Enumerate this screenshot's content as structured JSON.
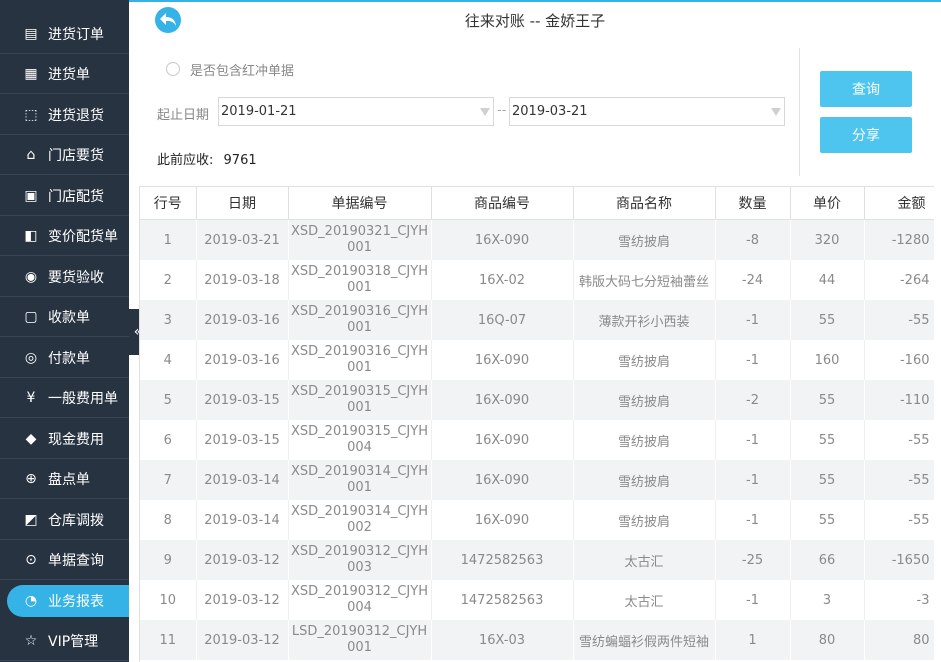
{
  "sidebar": {
    "items": [
      {
        "label": "进货订单",
        "icon": "purchase-order-icon"
      },
      {
        "label": "进货单",
        "icon": "purchase-receipt-icon"
      },
      {
        "label": "进货退货",
        "icon": "purchase-return-icon"
      },
      {
        "label": "门店要货",
        "icon": "store-request-icon"
      },
      {
        "label": "门店配货",
        "icon": "store-distribution-icon"
      },
      {
        "label": "变价配货单",
        "icon": "price-change-icon"
      },
      {
        "label": "要货验收",
        "icon": "inspection-icon"
      },
      {
        "label": "收款单",
        "icon": "receipt-icon"
      },
      {
        "label": "付款单",
        "icon": "payment-icon"
      },
      {
        "label": "一般费用单",
        "icon": "yen-icon"
      },
      {
        "label": "现金费用",
        "icon": "cash-bag-icon"
      },
      {
        "label": "盘点单",
        "icon": "stocktake-icon"
      },
      {
        "label": "仓库调拨",
        "icon": "transfer-icon"
      },
      {
        "label": "单据查询",
        "icon": "search-doc-icon"
      },
      {
        "label": "业务报表",
        "icon": "pie-chart-icon"
      },
      {
        "label": "VIP管理",
        "icon": "vip-icon"
      }
    ],
    "active_index": 14
  },
  "header": {
    "title": "往来对账 -- 金娇王子"
  },
  "filters": {
    "include_red_label": "是否包含红冲单据",
    "date_label": "起止日期",
    "start_date": "2019-01-21",
    "end_date": "2019-03-21",
    "range_sep": "--",
    "prior_receivable_label": "此前应收:",
    "prior_receivable_value": "9761"
  },
  "buttons": {
    "query": "查询",
    "share": "分享"
  },
  "table": {
    "columns": [
      "行号",
      "日期",
      "单据编号",
      "商品编号",
      "商品名称",
      "数量",
      "单价",
      "金额"
    ],
    "rows": [
      [
        "1",
        "2019-03-21",
        "XSD_20190321_CJYH001",
        "16X-090",
        "雪纺披肩",
        "-8",
        "320",
        "-1280"
      ],
      [
        "2",
        "2019-03-18",
        "XSD_20190318_CJYH001",
        "16X-02",
        "韩版大码七分短袖蕾丝",
        "-24",
        "44",
        "-264"
      ],
      [
        "3",
        "2019-03-16",
        "XSD_20190316_CJYH001",
        "16Q-07",
        "薄款开衫小西装",
        "-1",
        "55",
        "-55"
      ],
      [
        "4",
        "2019-03-16",
        "XSD_20190316_CJYH001",
        "16X-090",
        "雪纺披肩",
        "-1",
        "160",
        "-160"
      ],
      [
        "5",
        "2019-03-15",
        "XSD_20190315_CJYH001",
        "16X-090",
        "雪纺披肩",
        "-2",
        "55",
        "-110"
      ],
      [
        "6",
        "2019-03-15",
        "XSD_20190315_CJYH004",
        "16X-090",
        "雪纺披肩",
        "-1",
        "55",
        "-55"
      ],
      [
        "7",
        "2019-03-14",
        "XSD_20190314_CJYH001",
        "16X-090",
        "雪纺披肩",
        "-1",
        "55",
        "-55"
      ],
      [
        "8",
        "2019-03-14",
        "XSD_20190314_CJYH002",
        "16X-090",
        "雪纺披肩",
        "-1",
        "55",
        "-55"
      ],
      [
        "9",
        "2019-03-12",
        "XSD_20190312_CJYH003",
        "1472582563",
        "太古汇",
        "-25",
        "66",
        "-1650"
      ],
      [
        "10",
        "2019-03-12",
        "XSD_20190312_CJYH004",
        "1472582563",
        "太古汇",
        "-1",
        "3",
        "-3"
      ],
      [
        "11",
        "2019-03-12",
        "LSD_20190312_CJYH001",
        "16X-03",
        "雪纺蝙蝠衫假两件短袖",
        "1",
        "80",
        "80"
      ]
    ]
  },
  "colors": {
    "accent": "#35b3e6",
    "button": "#4ec5ee",
    "sidebar": "#283342"
  }
}
